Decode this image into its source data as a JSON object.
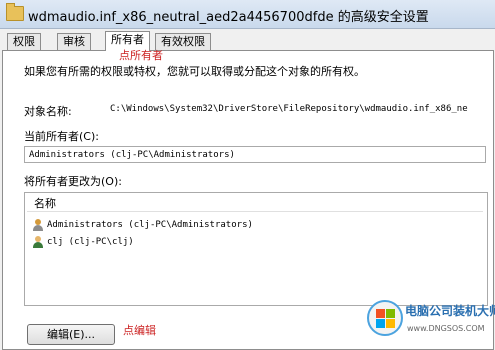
{
  "window": {
    "title": "wdmaudio.inf_x86_neutral_aed2a4456700dfde 的高级安全设置"
  },
  "tabs": [
    {
      "label": "权限",
      "active": false
    },
    {
      "label": "审核",
      "active": false
    },
    {
      "label": "所有者",
      "active": true
    },
    {
      "label": "有效权限",
      "active": false
    }
  ],
  "annotations": {
    "tab": "点所有者",
    "edit": "点编辑"
  },
  "owner_page": {
    "intro": "如果您有所需的权限或特权，您就可以取得或分配这个对象的所有权。",
    "object_name_label": "对象名称:",
    "object_name_value": "C:\\Windows\\System32\\DriverStore\\FileRepository\\wdmaudio.inf_x86_ne",
    "current_owner_label": "当前所有者(C):",
    "current_owner_value": "Administrators (clj-PC\\Administrators)",
    "change_owner_label": "将所有者更改为(O):",
    "list_header": "名称",
    "owners": [
      {
        "name": "Administrators (clj-PC\\Administrators)",
        "icon": "group-users-icon"
      },
      {
        "name": "clj (clj-PC\\clj)",
        "icon": "user-icon"
      }
    ],
    "edit_button": "编辑(E)..."
  },
  "watermark": {
    "line1": "电脑公司装机大师",
    "line2": "www.DNGSOS.COM"
  },
  "colors": {
    "annotation": "#cc2222",
    "panel": "#ffffff",
    "background": "#f0f0f0"
  }
}
